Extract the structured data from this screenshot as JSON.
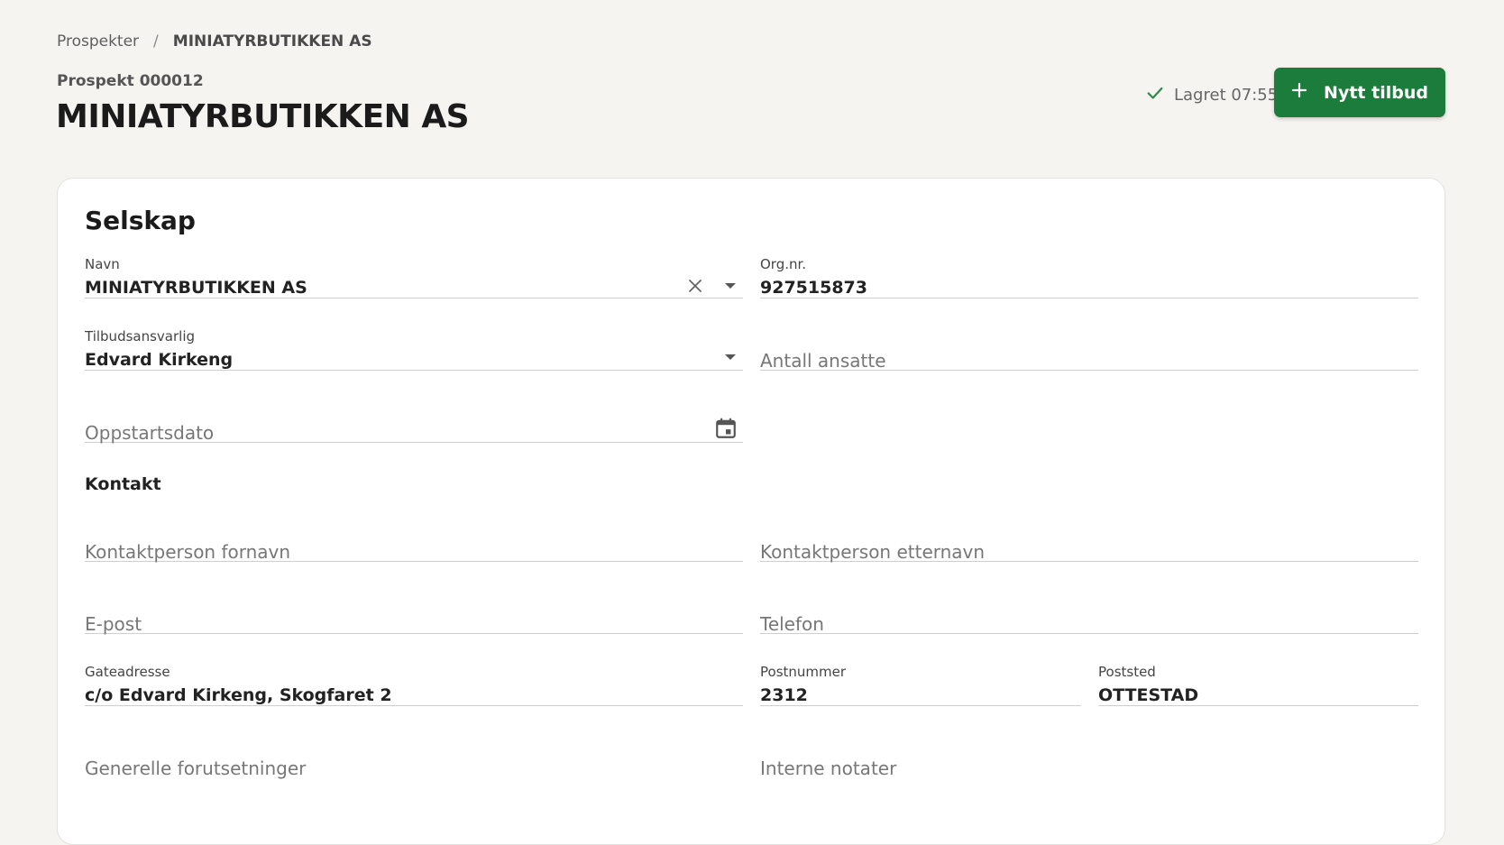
{
  "breadcrumb": {
    "parent": "Prospekter",
    "separator": "/",
    "current": "MINIATYRBUTIKKEN AS"
  },
  "header": {
    "subtitle": "Prospekt 000012",
    "title": "MINIATYRBUTIKKEN AS",
    "saved_text": "Lagret 07:55",
    "new_offer_label": "Nytt tilbud"
  },
  "colors": {
    "accent": "#1c7c3b",
    "saved_check": "#2e8b4a",
    "background": "#f5f4f1",
    "card": "#ffffff"
  },
  "company": {
    "section_title": "Selskap",
    "name": {
      "label": "Navn",
      "value": "MINIATYRBUTIKKEN AS"
    },
    "org_nr": {
      "label": "Org.nr.",
      "value": "927515873"
    },
    "responsible": {
      "label": "Tilbudsansvarlig",
      "value": "Edvard Kirkeng"
    },
    "employees": {
      "placeholder": "Antall ansatte"
    },
    "start_date": {
      "placeholder": "Oppstartsdato"
    }
  },
  "contact": {
    "section_title": "Kontakt",
    "first_name": {
      "placeholder": "Kontaktperson fornavn"
    },
    "last_name": {
      "placeholder": "Kontaktperson etternavn"
    },
    "email": {
      "placeholder": "E-post"
    },
    "phone": {
      "placeholder": "Telefon"
    },
    "street": {
      "label": "Gateadresse",
      "value": "c/o Edvard Kirkeng, Skogfaret 2"
    },
    "postal_code": {
      "label": "Postnummer",
      "value": "2312"
    },
    "city": {
      "label": "Poststed",
      "value": "OTTESTAD"
    },
    "general_conditions": {
      "placeholder": "Generelle forutsetninger"
    },
    "internal_notes": {
      "placeholder": "Interne notater"
    }
  },
  "icons": {
    "check": "check-icon",
    "plus": "plus-icon",
    "clear": "close-icon",
    "dropdown": "caret-down-icon",
    "calendar": "calendar-icon"
  }
}
